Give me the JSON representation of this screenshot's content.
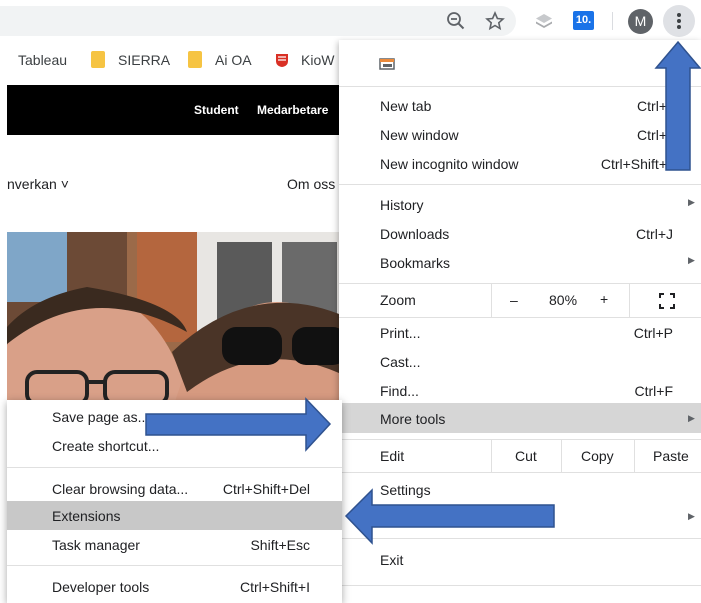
{
  "toolbar": {
    "extension_badge": "10.",
    "avatar_letter": "M"
  },
  "bookmarks": [
    "Tableau",
    "SIERRA",
    "Ai OA",
    "KioW"
  ],
  "page": {
    "nav_student": "Student",
    "nav_staff": "Medarbetare",
    "nav_left": "nverkan ˅",
    "nav_about": "Om oss"
  },
  "menu": {
    "new_tab": "New tab",
    "new_tab_sc": "Ctrl+",
    "new_window": "New window",
    "new_window_sc": "Ctrl+",
    "new_incognito": "New incognito window",
    "new_incognito_sc": "Ctrl+Shift+",
    "history": "History",
    "downloads": "Downloads",
    "downloads_sc": "Ctrl+J",
    "bookmarks": "Bookmarks",
    "zoom_label": "Zoom",
    "zoom_minus": "–",
    "zoom_value": "80%",
    "zoom_plus": "+",
    "print": "Print...",
    "print_sc": "Ctrl+P",
    "cast": "Cast...",
    "find": "Find...",
    "find_sc": "Ctrl+F",
    "more_tools": "More tools",
    "edit": "Edit",
    "cut": "Cut",
    "copy": "Copy",
    "paste": "Paste",
    "settings": "Settings",
    "exit": "Exit"
  },
  "submenu": {
    "save_page": "Save page as...",
    "create_shortcut": "Create shortcut...",
    "clear_data": "Clear browsing data...",
    "clear_data_sc": "Ctrl+Shift+Del",
    "extensions": "Extensions",
    "task_manager": "Task manager",
    "task_manager_sc": "Shift+Esc",
    "dev_tools": "Developer tools",
    "dev_tools_sc": "Ctrl+Shift+I"
  },
  "colors": {
    "annotation_arrow": "#4472c4",
    "menu_highlight": "#d6d6d6"
  }
}
